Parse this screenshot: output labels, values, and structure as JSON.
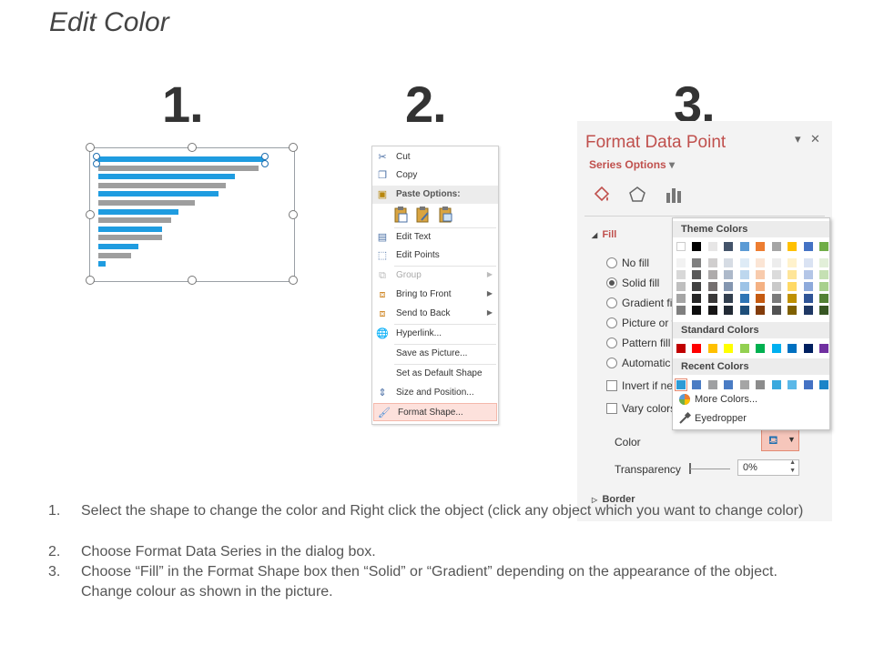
{
  "title": "Edit Color",
  "steps": [
    "1.",
    "2.",
    "3."
  ],
  "context_menu": {
    "items": [
      {
        "label": "Cut",
        "icon": "scissors-icon",
        "glyph": "✂"
      },
      {
        "label": "Copy",
        "icon": "copy-icon",
        "glyph": "❐"
      },
      {
        "label": "Paste Options:",
        "icon": "paste-icon",
        "glyph": "📋"
      },
      {
        "label": "Edit Text",
        "icon": "edit-text-icon",
        "glyph": "▤"
      },
      {
        "label": "Edit Points",
        "icon": "edit-points-icon",
        "glyph": "⬚"
      },
      {
        "label": "Group",
        "icon": "group-icon",
        "glyph": "⧉"
      },
      {
        "label": "Bring to Front",
        "icon": "bring-front-icon",
        "glyph": "⧈"
      },
      {
        "label": "Send to Back",
        "icon": "send-back-icon",
        "glyph": "⧈"
      },
      {
        "label": "Hyperlink...",
        "icon": "hyperlink-icon",
        "glyph": "🌐"
      },
      {
        "label": "Save as Picture...",
        "icon": "",
        "glyph": ""
      },
      {
        "label": "Set as Default Shape",
        "icon": "",
        "glyph": ""
      },
      {
        "label": "Size and Position...",
        "icon": "size-position-icon",
        "glyph": "⇕"
      },
      {
        "label": "Format Shape...",
        "icon": "format-shape-icon",
        "glyph": "🖌"
      }
    ]
  },
  "format_pane": {
    "title": "Format Data Point",
    "series_options": "Series Options",
    "fill_header": "Fill",
    "fill_options": [
      {
        "label": "No fill",
        "type": "radio",
        "checked": false
      },
      {
        "label": "Solid fill",
        "type": "radio",
        "checked": true
      },
      {
        "label": "Gradient fi",
        "type": "radio",
        "checked": false
      },
      {
        "label": "Picture or t",
        "type": "radio",
        "checked": false
      },
      {
        "label": "Pattern fill",
        "type": "radio",
        "checked": false
      },
      {
        "label": "Automatic",
        "type": "radio",
        "checked": false
      },
      {
        "label": "Invert if ne",
        "type": "checkbox",
        "checked": false
      },
      {
        "label": "Vary colors",
        "type": "checkbox",
        "checked": false
      }
    ],
    "color_label": "Color",
    "transparency_label": "Transparency",
    "transparency_value": "0%",
    "border_header": "Border"
  },
  "color_picker": {
    "theme_colors_label": "Theme Colors",
    "standard_colors_label": "Standard Colors",
    "recent_colors_label": "Recent Colors",
    "more_colors_label": "More Colors...",
    "eyedropper_label": "Eyedropper",
    "theme_top": [
      "#ffffff",
      "#000000",
      "#e7e6e6",
      "#44546a",
      "#5b9bd5",
      "#ed7d31",
      "#a5a5a5",
      "#ffc000",
      "#4472c4",
      "#70ad47"
    ],
    "theme_shades": [
      [
        "#f2f2f2",
        "#808080",
        "#d0cece",
        "#d6dce4",
        "#deebf6",
        "#fbe5d5",
        "#ededed",
        "#fff2cc",
        "#dae3f3",
        "#e2efd9"
      ],
      [
        "#d8d8d8",
        "#595959",
        "#aeabab",
        "#adb9ca",
        "#bdd7ee",
        "#f8cbad",
        "#dbdbdb",
        "#fee599",
        "#b4c6e7",
        "#c5e0b3"
      ],
      [
        "#bfbfbf",
        "#404040",
        "#757070",
        "#8496b0",
        "#9dc3e6",
        "#f4b183",
        "#c9c9c9",
        "#ffd965",
        "#8eaadb",
        "#a8d08d"
      ],
      [
        "#a5a5a5",
        "#262626",
        "#3a3838",
        "#323f4f",
        "#2e75b5",
        "#c55a11",
        "#7b7b7b",
        "#bf9000",
        "#2f5496",
        "#538135"
      ],
      [
        "#7f7f7f",
        "#0d0d0d",
        "#171616",
        "#222a35",
        "#1e4e79",
        "#833c0b",
        "#525252",
        "#7f6000",
        "#1f3864",
        "#375623"
      ]
    ],
    "standard": [
      "#c00000",
      "#ff0000",
      "#ffc000",
      "#ffff00",
      "#92d050",
      "#00b050",
      "#00b0f0",
      "#0070c0",
      "#002060",
      "#7030a0"
    ],
    "recent": [
      "#2e9bd6",
      "#4a7cc4",
      "#9fa0a2",
      "#4a7cc4",
      "#a5a5a5",
      "#8c8c8c",
      "#3aa9de",
      "#5bb8e8",
      "#4472c4",
      "#1a84c8"
    ]
  },
  "chart_bar_colors": {
    "blue": "#1f9ce0",
    "gray": "#9e9e9e"
  },
  "instructions": [
    {
      "num": "1.",
      "text": "Select the shape to change the color and Right click the object (click any object which you want to change color)"
    },
    {
      "num": "2.",
      "text": "Choose Format Data Series in the dialog box."
    },
    {
      "num": "3.",
      "text": "Choose “Fill” in the Format Shape box then “Solid” or “Gradient” depending on the appearance of the object. Change colour as shown in the picture."
    }
  ]
}
